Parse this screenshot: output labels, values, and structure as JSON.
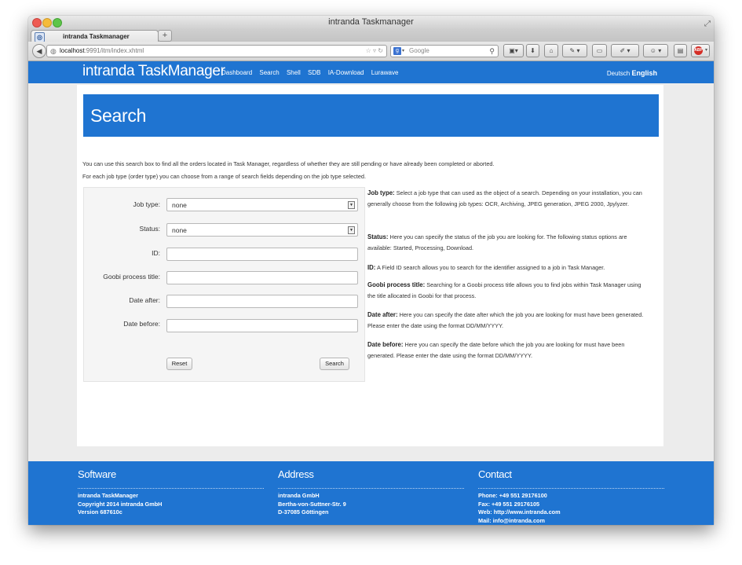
{
  "browser": {
    "window_title": "intranda Taskmanager",
    "tab_title": "intranda Taskmanager",
    "url_host": "localhost",
    "url_path": ":9991/itm/index.xhtml",
    "search_placeholder": "Google"
  },
  "app": {
    "brand": "intranda TaskManager",
    "nav": [
      "Dashboard",
      "Search",
      "Shell",
      "SDB",
      "IA-Download",
      "Lurawave"
    ],
    "lang_other": "Deutsch",
    "lang_selected": "English"
  },
  "page": {
    "title": "Search",
    "intro_1": "You can use this search box to find all the orders located in Task Manager, regardless of whether they are still pending or have already been completed or aborted.",
    "intro_2": "For each job type (order type) you can choose from a range of search fields depending on the job type selected."
  },
  "form": {
    "job_type_label": "Job type:",
    "job_type_value": "none",
    "status_label": "Status:",
    "status_value": "none",
    "id_label": "ID:",
    "goobi_label": "Goobi process title:",
    "date_after_label": "Date after:",
    "date_before_label": "Date before:",
    "reset_label": "Reset",
    "search_label": "Search"
  },
  "help": [
    {
      "term": "Job type:",
      "text": "Select a job type that can used as the object of a search. Depending on your installation, you can generally choose from the following job types: OCR, Archiving, JPEG generation, JPEG 2000, Jpylyzer."
    },
    {
      "term": "Status:",
      "text": "Here you can specify the status of the job you are looking for. The following status options are available: Started, Processing, Download."
    },
    {
      "term": "ID:",
      "text": "A Field ID search allows you to search for the identifier assigned to a job in Task Manager."
    },
    {
      "term": "Goobi process title:",
      "text": "Searching for a Goobi process title allows you to find jobs within Task Manager using the title allocated in Goobi for that process."
    },
    {
      "term": "Date after:",
      "text": "Here you can specify the date after which the job you are looking for must have been generated. Please enter the date using the format DD/MM/YYYY."
    },
    {
      "term": "Date before:",
      "text": "Here you can specify the date before which the job you are looking for must have been generated. Please enter the date using the format DD/MM/YYYY."
    }
  ],
  "footer": {
    "software": {
      "title": "Software",
      "lines": [
        "intranda TaskManager",
        "Copyright 2014 intranda GmbH",
        "Version 687610c"
      ]
    },
    "address": {
      "title": "Address",
      "lines": [
        "intranda GmbH",
        "Bertha-von-Suttner-Str. 9",
        "D-37085 Göttingen"
      ]
    },
    "contact": {
      "title": "Contact",
      "lines": [
        "Phone: +49 551 29176100",
        "Fax: +49 551 29176105",
        "Web: http://www.intranda.com",
        "Mail: info@intranda.com"
      ]
    }
  },
  "colors": {
    "brand_blue": "#1f74d1"
  }
}
